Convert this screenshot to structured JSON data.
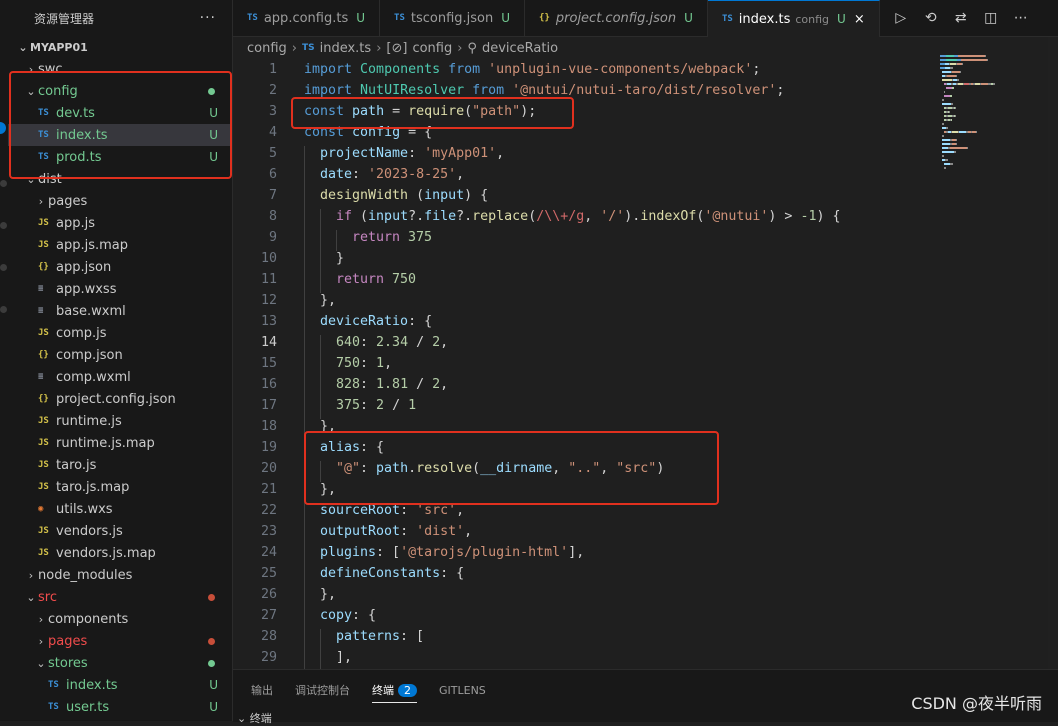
{
  "explorer": {
    "title": "资源管理器",
    "more": "···",
    "root": "MYAPP01"
  },
  "tree": [
    {
      "label": "swc",
      "indent": 0,
      "chev": "›",
      "icon": "",
      "status": "",
      "cls": ""
    },
    {
      "label": "config",
      "indent": 0,
      "chev": "⌄",
      "icon": "",
      "status": "●",
      "statusColor": "#73c991",
      "cls": "green"
    },
    {
      "label": "dev.ts",
      "indent": 1,
      "chev": "",
      "icon": "TS",
      "iconCls": "c-ts",
      "status": "U",
      "statusColor": "#73c991",
      "cls": "green"
    },
    {
      "label": "index.ts",
      "indent": 1,
      "chev": "",
      "icon": "TS",
      "iconCls": "c-ts",
      "status": "U",
      "statusColor": "#73c991",
      "cls": "green",
      "selected": true
    },
    {
      "label": "prod.ts",
      "indent": 1,
      "chev": "",
      "icon": "TS",
      "iconCls": "c-ts",
      "status": "U",
      "statusColor": "#73c991",
      "cls": "green"
    },
    {
      "label": "dist",
      "indent": 0,
      "chev": "⌄",
      "icon": "",
      "status": "",
      "cls": ""
    },
    {
      "label": "pages",
      "indent": 1,
      "chev": "›",
      "icon": "",
      "status": "",
      "cls": ""
    },
    {
      "label": "app.js",
      "indent": 1,
      "chev": "",
      "icon": "JS",
      "iconCls": "c-js",
      "status": "",
      "cls": ""
    },
    {
      "label": "app.js.map",
      "indent": 1,
      "chev": "",
      "icon": "JS",
      "iconCls": "c-js",
      "status": "",
      "cls": ""
    },
    {
      "label": "app.json",
      "indent": 1,
      "chev": "",
      "icon": "{}",
      "iconCls": "c-json",
      "status": "",
      "cls": ""
    },
    {
      "label": "app.wxss",
      "indent": 1,
      "chev": "",
      "icon": "≡",
      "iconCls": "c-wx",
      "status": "",
      "cls": ""
    },
    {
      "label": "base.wxml",
      "indent": 1,
      "chev": "",
      "icon": "≡",
      "iconCls": "c-wx",
      "status": "",
      "cls": ""
    },
    {
      "label": "comp.js",
      "indent": 1,
      "chev": "",
      "icon": "JS",
      "iconCls": "c-js",
      "status": "",
      "cls": ""
    },
    {
      "label": "comp.json",
      "indent": 1,
      "chev": "",
      "icon": "{}",
      "iconCls": "c-json",
      "status": "",
      "cls": ""
    },
    {
      "label": "comp.wxml",
      "indent": 1,
      "chev": "",
      "icon": "≡",
      "iconCls": "c-wx",
      "status": "",
      "cls": ""
    },
    {
      "label": "project.config.json",
      "indent": 1,
      "chev": "",
      "icon": "{}",
      "iconCls": "c-json",
      "status": "",
      "cls": ""
    },
    {
      "label": "runtime.js",
      "indent": 1,
      "chev": "",
      "icon": "JS",
      "iconCls": "c-js",
      "status": "",
      "cls": ""
    },
    {
      "label": "runtime.js.map",
      "indent": 1,
      "chev": "",
      "icon": "JS",
      "iconCls": "c-js",
      "status": "",
      "cls": ""
    },
    {
      "label": "taro.js",
      "indent": 1,
      "chev": "",
      "icon": "JS",
      "iconCls": "c-js",
      "status": "",
      "cls": ""
    },
    {
      "label": "taro.js.map",
      "indent": 1,
      "chev": "",
      "icon": "JS",
      "iconCls": "c-js",
      "status": "",
      "cls": ""
    },
    {
      "label": "utils.wxs",
      "indent": 1,
      "chev": "",
      "icon": "◉",
      "iconCls": "c-rss",
      "status": "",
      "cls": ""
    },
    {
      "label": "vendors.js",
      "indent": 1,
      "chev": "",
      "icon": "JS",
      "iconCls": "c-js",
      "status": "",
      "cls": ""
    },
    {
      "label": "vendors.js.map",
      "indent": 1,
      "chev": "",
      "icon": "JS",
      "iconCls": "c-js",
      "status": "",
      "cls": ""
    },
    {
      "label": "node_modules",
      "indent": 0,
      "chev": "›",
      "icon": "",
      "status": "",
      "cls": ""
    },
    {
      "label": "src",
      "indent": 0,
      "chev": "⌄",
      "icon": "",
      "status": "●",
      "statusColor": "#c74e39",
      "cls": "red"
    },
    {
      "label": "components",
      "indent": 1,
      "chev": "›",
      "icon": "",
      "status": "",
      "cls": ""
    },
    {
      "label": "pages",
      "indent": 1,
      "chev": "›",
      "icon": "",
      "status": "●",
      "statusColor": "#c74e39",
      "cls": "red"
    },
    {
      "label": "stores",
      "indent": 1,
      "chev": "⌄",
      "icon": "",
      "status": "●",
      "statusColor": "#73c991",
      "cls": "green"
    },
    {
      "label": "index.ts",
      "indent": 2,
      "chev": "",
      "icon": "TS",
      "iconCls": "c-ts",
      "status": "U",
      "statusColor": "#73c991",
      "cls": "green"
    },
    {
      "label": "user.ts",
      "indent": 2,
      "chev": "",
      "icon": "TS",
      "iconCls": "c-ts",
      "status": "U",
      "statusColor": "#73c991",
      "cls": "green"
    }
  ],
  "tabs": [
    {
      "icon": "TS",
      "label": "app.config.ts",
      "status": "U"
    },
    {
      "icon": "TS",
      "label": "tsconfig.json",
      "status": "U"
    },
    {
      "icon": "{}",
      "label": "project.config.json",
      "status": "U",
      "italic": true
    },
    {
      "icon": "TS",
      "label": "index.ts",
      "desc": "config",
      "status": "U",
      "close": "×",
      "active": true
    }
  ],
  "toolbar": [
    "▷",
    "⟲",
    "⇄",
    "◫",
    "⋯"
  ],
  "breadcrumb": [
    "config",
    "›",
    "TS",
    "index.ts",
    "›",
    "[⊘]",
    "config",
    "›",
    "⚲",
    "deviceRatio"
  ],
  "code": [
    {
      "n": "1",
      "tokens": [
        [
          "k",
          "import "
        ],
        [
          "t",
          "Components "
        ],
        [
          "k",
          "from "
        ],
        [
          "s",
          "'unplugin-vue-components/webpack'"
        ],
        [
          "p",
          ";"
        ]
      ]
    },
    {
      "n": "2",
      "tokens": [
        [
          "k",
          "import "
        ],
        [
          "t",
          "NutUIResolver "
        ],
        [
          "k",
          "from "
        ],
        [
          "s",
          "'@nutui/nutui-taro/dist/resolver'"
        ],
        [
          "p",
          ";"
        ]
      ]
    },
    {
      "n": "3",
      "tokens": [
        [
          "k",
          "const "
        ],
        [
          "v",
          "path "
        ],
        [
          "p",
          "= "
        ],
        [
          "f",
          "require"
        ],
        [
          "p",
          "("
        ],
        [
          "s",
          "\"path\""
        ],
        [
          "p",
          ");"
        ]
      ]
    },
    {
      "n": "4",
      "tokens": [
        [
          "k",
          "const "
        ],
        [
          "v",
          "config "
        ],
        [
          "p",
          "= {"
        ]
      ]
    },
    {
      "n": "5",
      "indent": 1,
      "tokens": [
        [
          "v",
          "projectName"
        ],
        [
          "p",
          ": "
        ],
        [
          "s",
          "'myApp01'"
        ],
        [
          "p",
          ","
        ]
      ]
    },
    {
      "n": "6",
      "indent": 1,
      "tokens": [
        [
          "v",
          "date"
        ],
        [
          "p",
          ": "
        ],
        [
          "s",
          "'2023-8-25'"
        ],
        [
          "p",
          ","
        ]
      ]
    },
    {
      "n": "7",
      "indent": 1,
      "tokens": [
        [
          "f",
          "designWidth "
        ],
        [
          "p",
          "("
        ],
        [
          "v",
          "input"
        ],
        [
          "p",
          ") {"
        ]
      ]
    },
    {
      "n": "8",
      "indent": 2,
      "tokens": [
        [
          "kw",
          "if "
        ],
        [
          "p",
          "("
        ],
        [
          "v",
          "input"
        ],
        [
          "p",
          "?."
        ],
        [
          "v",
          "file"
        ],
        [
          "p",
          "?."
        ],
        [
          "f",
          "replace"
        ],
        [
          "p",
          "("
        ],
        [
          "r",
          "/\\\\+/g"
        ],
        [
          "p",
          ", "
        ],
        [
          "s",
          "'/'"
        ],
        [
          "p",
          ")."
        ],
        [
          "f",
          "indexOf"
        ],
        [
          "p",
          "("
        ],
        [
          "s",
          "'@nutui'"
        ],
        [
          "p",
          ") > "
        ],
        [
          "n",
          "-1"
        ],
        [
          "p",
          ") {"
        ]
      ]
    },
    {
      "n": "9",
      "indent": 3,
      "tokens": [
        [
          "kw",
          "return "
        ],
        [
          "n",
          "375"
        ]
      ]
    },
    {
      "n": "10",
      "indent": 2,
      "tokens": [
        [
          "p",
          "}"
        ]
      ]
    },
    {
      "n": "11",
      "indent": 2,
      "tokens": [
        [
          "kw",
          "return "
        ],
        [
          "n",
          "750"
        ]
      ]
    },
    {
      "n": "12",
      "indent": 1,
      "tokens": [
        [
          "p",
          "},"
        ]
      ]
    },
    {
      "n": "13",
      "indent": 1,
      "tokens": [
        [
          "v",
          "deviceRatio"
        ],
        [
          "p",
          ": {"
        ]
      ]
    },
    {
      "n": "14",
      "indent": 2,
      "cur": true,
      "tokens": [
        [
          "n",
          "640"
        ],
        [
          "p",
          ": "
        ],
        [
          "n",
          "2.34 "
        ],
        [
          "p",
          "/ "
        ],
        [
          "n",
          "2"
        ],
        [
          "p",
          ","
        ]
      ]
    },
    {
      "n": "15",
      "indent": 2,
      "tokens": [
        [
          "n",
          "750"
        ],
        [
          "p",
          ": "
        ],
        [
          "n",
          "1"
        ],
        [
          "p",
          ","
        ]
      ]
    },
    {
      "n": "16",
      "indent": 2,
      "tokens": [
        [
          "n",
          "828"
        ],
        [
          "p",
          ": "
        ],
        [
          "n",
          "1.81 "
        ],
        [
          "p",
          "/ "
        ],
        [
          "n",
          "2"
        ],
        [
          "p",
          ","
        ]
      ]
    },
    {
      "n": "17",
      "indent": 2,
      "tokens": [
        [
          "n",
          "375"
        ],
        [
          "p",
          ": "
        ],
        [
          "n",
          "2 "
        ],
        [
          "p",
          "/ "
        ],
        [
          "n",
          "1"
        ]
      ]
    },
    {
      "n": "18",
      "indent": 1,
      "tokens": [
        [
          "p",
          "},"
        ]
      ]
    },
    {
      "n": "19",
      "indent": 1,
      "tokens": [
        [
          "v",
          "alias"
        ],
        [
          "p",
          ": {"
        ]
      ]
    },
    {
      "n": "20",
      "indent": 2,
      "tokens": [
        [
          "s",
          "\"@\""
        ],
        [
          "p",
          ": "
        ],
        [
          "v",
          "path"
        ],
        [
          "p",
          "."
        ],
        [
          "f",
          "resolve"
        ],
        [
          "p",
          "("
        ],
        [
          "v",
          "__dirname"
        ],
        [
          "p",
          ", "
        ],
        [
          "s",
          "\"..\""
        ],
        [
          "p",
          ", "
        ],
        [
          "s",
          "\"src\""
        ],
        [
          "p",
          ")"
        ]
      ]
    },
    {
      "n": "21",
      "indent": 1,
      "tokens": [
        [
          "p",
          "},"
        ]
      ]
    },
    {
      "n": "22",
      "indent": 1,
      "tokens": [
        [
          "v",
          "sourceRoot"
        ],
        [
          "p",
          ": "
        ],
        [
          "s",
          "'src'"
        ],
        [
          "p",
          ","
        ]
      ]
    },
    {
      "n": "23",
      "indent": 1,
      "tokens": [
        [
          "v",
          "outputRoot"
        ],
        [
          "p",
          ": "
        ],
        [
          "s",
          "'dist'"
        ],
        [
          "p",
          ","
        ]
      ]
    },
    {
      "n": "24",
      "indent": 1,
      "tokens": [
        [
          "v",
          "plugins"
        ],
        [
          "p",
          ": ["
        ],
        [
          "s",
          "'@tarojs/plugin-html'"
        ],
        [
          "p",
          "],"
        ]
      ]
    },
    {
      "n": "25",
      "indent": 1,
      "tokens": [
        [
          "v",
          "defineConstants"
        ],
        [
          "p",
          ": {"
        ]
      ]
    },
    {
      "n": "26",
      "indent": 1,
      "tokens": [
        [
          "p",
          "},"
        ]
      ]
    },
    {
      "n": "27",
      "indent": 1,
      "tokens": [
        [
          "v",
          "copy"
        ],
        [
          "p",
          ": {"
        ]
      ]
    },
    {
      "n": "28",
      "indent": 2,
      "tokens": [
        [
          "v",
          "patterns"
        ],
        [
          "p",
          ": ["
        ]
      ]
    },
    {
      "n": "29",
      "indent": 2,
      "tokens": [
        [
          "p",
          "],"
        ]
      ]
    }
  ],
  "panel": {
    "tabs": [
      "输出",
      "调试控制台",
      "终端",
      "GITLENS"
    ],
    "active": "终端",
    "badge": "2",
    "sub": "⌄ 终端",
    "watermark": "CSDN @夜半听雨"
  }
}
